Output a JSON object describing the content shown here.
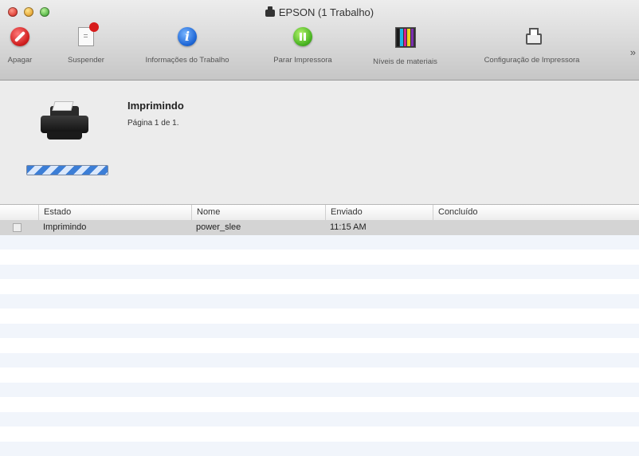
{
  "window": {
    "title": "EPSON (1 Trabalho)"
  },
  "toolbar": {
    "items": [
      {
        "label": "Apagar",
        "icon": "delete-icon"
      },
      {
        "label": "Suspender",
        "icon": "suspend-icon"
      },
      {
        "label": "Informações do Trabalho",
        "icon": "info-icon"
      },
      {
        "label": "Parar Impressora",
        "icon": "pause-icon"
      },
      {
        "label": "Níveis de materiais",
        "icon": "supply-levels-icon"
      },
      {
        "label": "Configuração de Impressora",
        "icon": "printer-setup-icon"
      }
    ],
    "overflow": "»"
  },
  "status": {
    "title": "Imprimindo",
    "subtitle": "Página 1 de 1."
  },
  "table": {
    "columns": [
      "Estado",
      "Nome",
      "Enviado",
      "Concluído"
    ],
    "rows": [
      {
        "estado": "Imprimindo",
        "nome": "power_slee",
        "enviado": "11:15 AM",
        "concluido": ""
      }
    ]
  },
  "colors": {
    "delete": "#d01f1f",
    "info": "#1f67d6",
    "pause": "#48b321",
    "progress": "#3c7ed6",
    "ink_levels": [
      "#1a1a1a",
      "#1fb4e6",
      "#d21f8f",
      "#f0d21f",
      "#7d2fb0"
    ]
  }
}
